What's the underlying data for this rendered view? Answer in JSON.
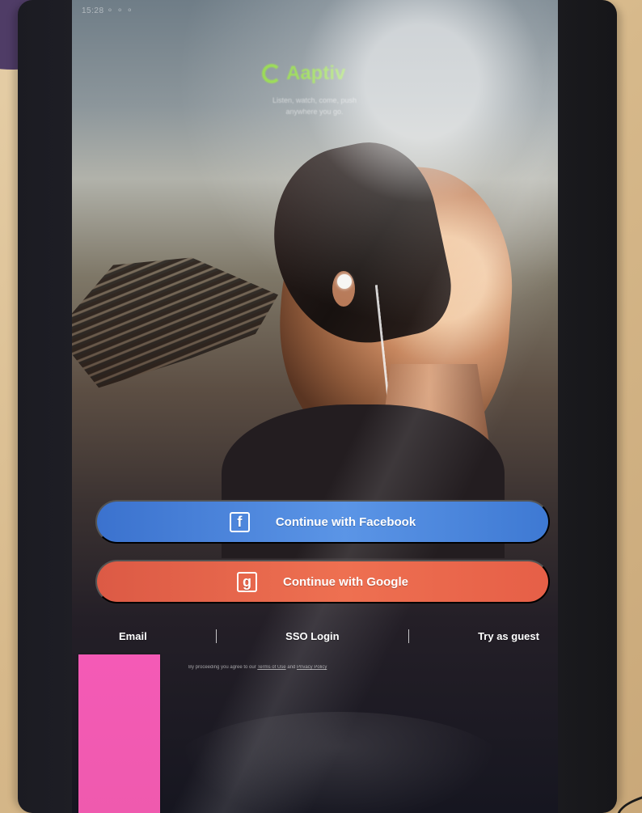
{
  "status_bar": "15:28 ⚬ ⚬ ⚬",
  "app": {
    "logo_text": "Aaptiv",
    "tagline_line_1": "Listen, watch, come, push",
    "tagline_line_2": "anywhere you go."
  },
  "actions": {
    "facebook_label": "Continue with Facebook",
    "google_label": "Continue with Google",
    "facebook_icon": "f",
    "google_icon": "g"
  },
  "links": {
    "email": "Email",
    "sso": "SSO Login",
    "guest": "Try as guest"
  },
  "legal": {
    "prefix": "By proceeding you agree to our",
    "terms": "Terms of Use",
    "middle": "and",
    "privacy": "Privacy Policy"
  },
  "colors": {
    "facebook": "#4A85DD",
    "google": "#E9674E",
    "logo": "#8DDF31",
    "sticky_note": "#F45AB6"
  }
}
